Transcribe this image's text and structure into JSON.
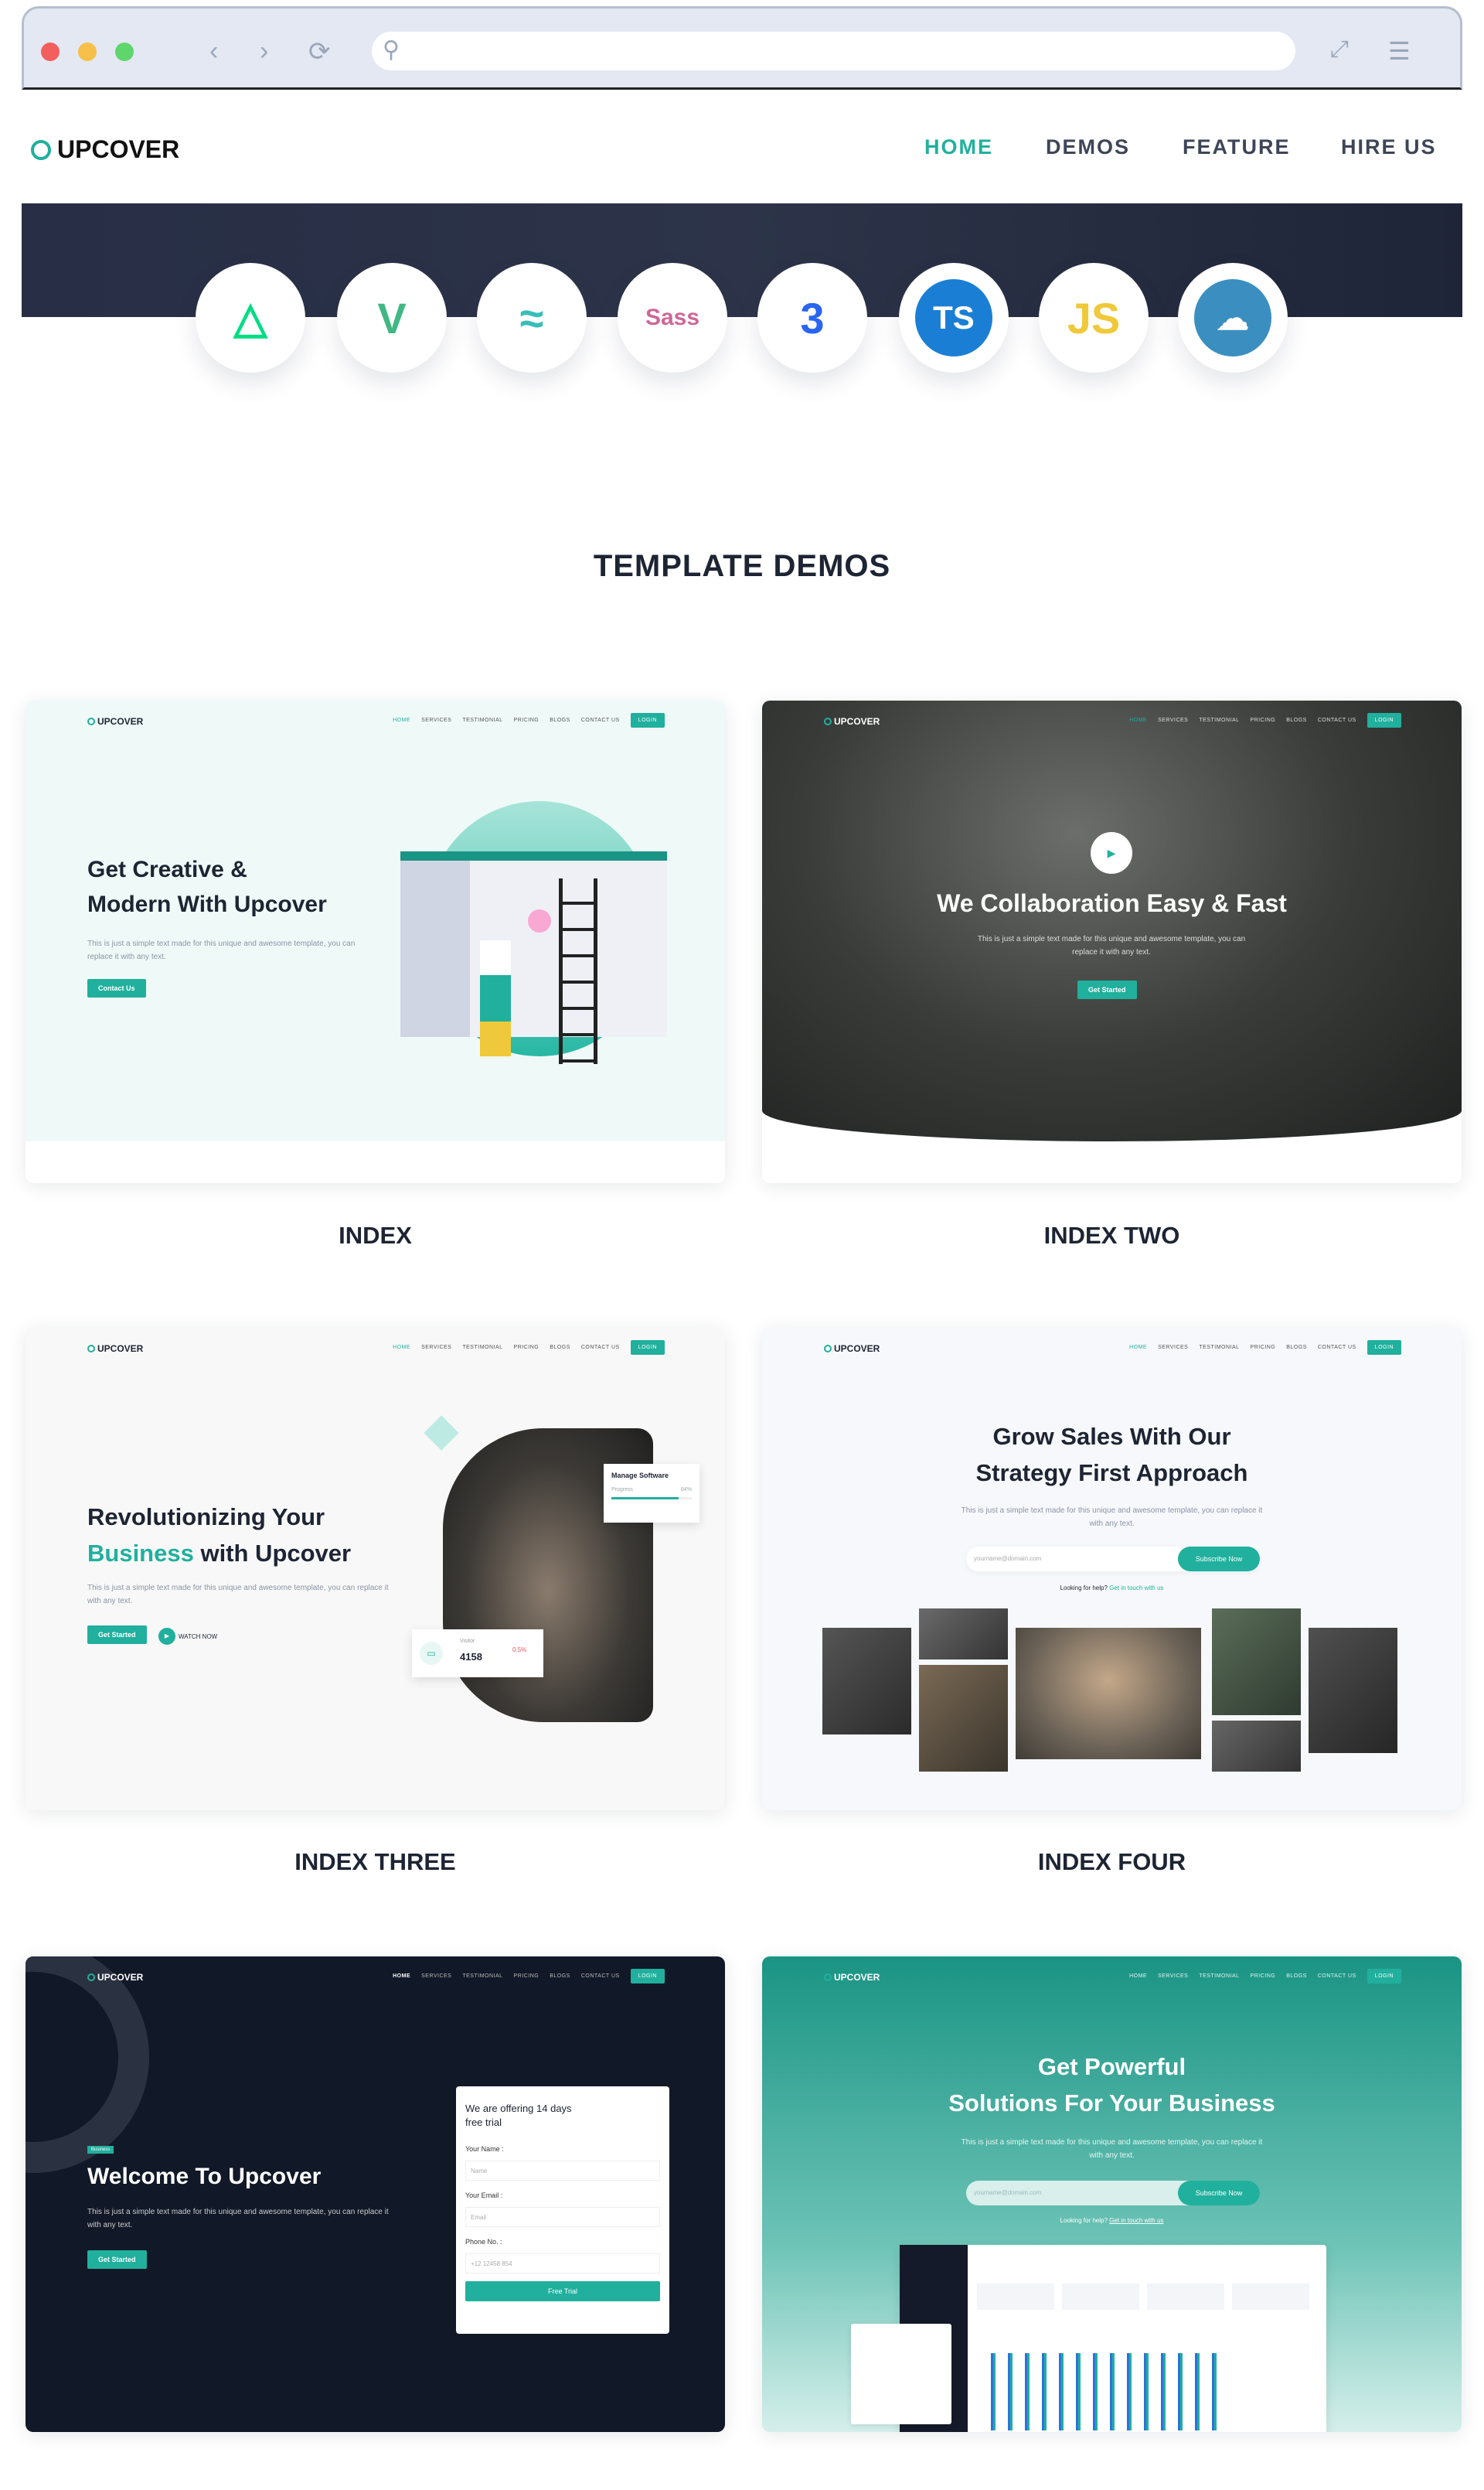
{
  "site": {
    "logo": "UPCOVER"
  },
  "nav": [
    {
      "label": "HOME",
      "active": true
    },
    {
      "label": "DEMOS"
    },
    {
      "label": "FEATURE"
    },
    {
      "label": "HIRE US"
    }
  ],
  "tech_icons": [
    {
      "name": "nuxt-icon",
      "glyph": "△",
      "color": "#00dc82"
    },
    {
      "name": "vue-icon",
      "glyph": "V",
      "color": "#41b883"
    },
    {
      "name": "tailwind-icon",
      "glyph": "≈",
      "color": "#38bdb8"
    },
    {
      "name": "sass-icon",
      "glyph": "Sass",
      "color": "#cd6799"
    },
    {
      "name": "css3-icon",
      "glyph": "3",
      "color": "#2965f1"
    },
    {
      "name": "typescript-icon",
      "glyph": "TS",
      "color": "#1a7fd4"
    },
    {
      "name": "javascript-icon",
      "glyph": "JS",
      "color": "#f0c93a"
    },
    {
      "name": "postcss-icon",
      "glyph": "☁",
      "color": "#3b8fc0"
    }
  ],
  "section_title": "TEMPLATE DEMOS",
  "mini_nav": [
    "HOME",
    "SERVICES",
    "TESTIMONIAL",
    "PRICING",
    "BLOGS",
    "CONTACT US"
  ],
  "mini_login": "LOGIN",
  "demos": [
    {
      "label": "INDEX",
      "heading1": "Get Creative &",
      "heading2": "Modern With Upcover",
      "text": "This is just a simple text made for this unique and awesome template, you can replace it with any text.",
      "button": "Contact Us"
    },
    {
      "label": "INDEX TWO",
      "heading": "We Collaboration Easy & Fast",
      "text": "This is just a simple text made for this unique and awesome template, you can replace it with any text.",
      "button": "Get Started"
    },
    {
      "label": "INDEX THREE",
      "heading1": "Revolutionizing Your",
      "heading_accent": "Business",
      "heading2": " with Upcover",
      "text": "This is just a simple text made for this unique and awesome template, you can replace it with any text.",
      "button": "Get Started",
      "watch": "WATCH NOW",
      "manage_title": "Manage Software",
      "progress_label": "Progress",
      "progress_value": "84%",
      "progress": 84,
      "visitor_label": "Visitor",
      "visitor_value": "4158",
      "visitor_change": "0.5%"
    },
    {
      "label": "INDEX FOUR",
      "heading1": "Grow Sales With Our",
      "heading2": "Strategy First Approach",
      "text": "This is just a simple text made for this unique and awesome template, you can replace it with any text.",
      "email_placeholder": "yourname@domain.com",
      "subscribe": "Subscribe Now",
      "help": "Looking for help?",
      "help_link": "Get in touch with us"
    },
    {
      "label": "",
      "badge": "Business",
      "heading": "Welcome To Upcover",
      "text": "This is just a simple text made for this unique and awesome template, you can replace it with any text.",
      "button": "Get Started",
      "form_title": "We are offering 14 days free trial",
      "name_label": "Your Name :",
      "name_placeholder": "Name",
      "email_label": "Your Email :",
      "email_placeholder": "Email",
      "phone_label": "Phone No. :",
      "phone_placeholder": "+12 12458 854",
      "submit": "Free Trial"
    },
    {
      "label": "",
      "heading1": "Get Powerful",
      "heading2": "Solutions For Your Business",
      "text": "This is just a simple text made for this unique and awesome template, you can replace it with any text.",
      "email_placeholder": "yourname@domain.com",
      "subscribe": "Subscribe Now",
      "help": "Looking for help?",
      "help_link": "Get in touch with us"
    }
  ],
  "colors": {
    "accent": "#20b09d",
    "dark": "#111827",
    "banner": "#272e45"
  }
}
